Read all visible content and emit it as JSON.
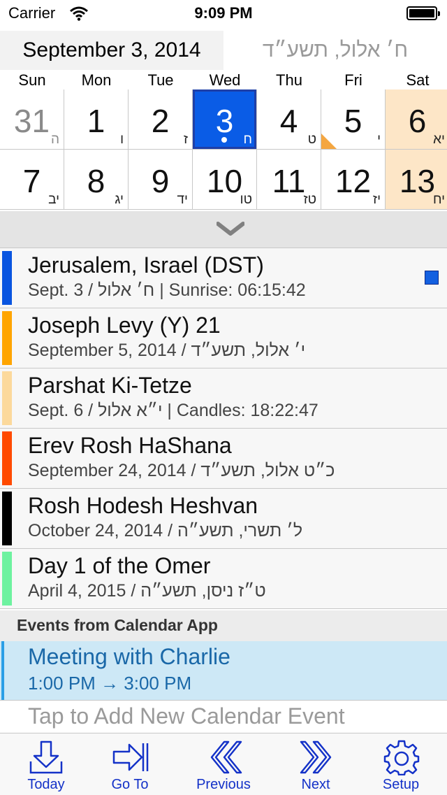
{
  "status_bar": {
    "carrier": "Carrier",
    "time": "9:09 PM"
  },
  "header": {
    "gregorian_date": "September 3, 2014",
    "hebrew_date": "ח׳ אלול, תשע״ד"
  },
  "weekdays": [
    "Sun",
    "Mon",
    "Tue",
    "Wed",
    "Thu",
    "Fri",
    "Sat"
  ],
  "calendar": {
    "weeks": [
      [
        {
          "day": "31",
          "heb": "ה"
        },
        {
          "day": "1",
          "heb": "ו"
        },
        {
          "day": "2",
          "heb": "ז"
        },
        {
          "day": "3",
          "heb": "ח"
        },
        {
          "day": "4",
          "heb": "ט"
        },
        {
          "day": "5",
          "heb": "י"
        },
        {
          "day": "6",
          "heb": "יא"
        }
      ],
      [
        {
          "day": "7",
          "heb": "יב"
        },
        {
          "day": "8",
          "heb": "יג"
        },
        {
          "day": "9",
          "heb": "יד"
        },
        {
          "day": "10",
          "heb": "טו"
        },
        {
          "day": "11",
          "heb": "טז"
        },
        {
          "day": "12",
          "heb": "יז"
        },
        {
          "day": "13",
          "heb": "יח"
        }
      ]
    ]
  },
  "events": [
    {
      "title": "Jerusalem, Israel (DST)",
      "subtitle": "Sept. 3 / ח׳ אלול | Sunrise: 06:15:42",
      "color": "#0a55e0"
    },
    {
      "title": "Joseph Levy (Y) 21",
      "subtitle": "September 5, 2014 / י׳ אלול, תשע״ד",
      "color": "#ffa500"
    },
    {
      "title": "Parshat Ki-Tetze",
      "subtitle": "Sept. 6 / י״א אלול | Candles: 18:22:47",
      "color": "#fcd99c"
    },
    {
      "title": "Erev Rosh HaShana",
      "subtitle": "September 24, 2014 / כ״ט אלול, תשע״ד",
      "color": "#ff4a00"
    },
    {
      "title": "Rosh Hodesh Heshvan",
      "subtitle": "October 24, 2014 / ל׳ תשרי, תשע״ה",
      "color": "#000000"
    },
    {
      "title": "Day 1 of the Omer",
      "subtitle": "April 4, 2015 / ט״ז ניסן, תשע״ה",
      "color": "#6ef2a0"
    }
  ],
  "calendar_app": {
    "section_title": "Events from Calendar App",
    "event_title": "Meeting with Charlie",
    "event_time": "1:00 PM → 3:00 PM",
    "add_prompt": "Tap to Add New Calendar Event"
  },
  "tabs": [
    {
      "label": "Today",
      "icon": "download-arrow-icon"
    },
    {
      "label": "Go To",
      "icon": "goto-arrow-icon"
    },
    {
      "label": "Previous",
      "icon": "double-chevron-left-icon"
    },
    {
      "label": "Next",
      "icon": "double-chevron-right-icon"
    },
    {
      "label": "Setup",
      "icon": "gear-icon"
    }
  ],
  "colors": {
    "accent": "#1432c8",
    "today_cell": "#0a5ce6",
    "saturday_cell": "#fde6c7"
  }
}
